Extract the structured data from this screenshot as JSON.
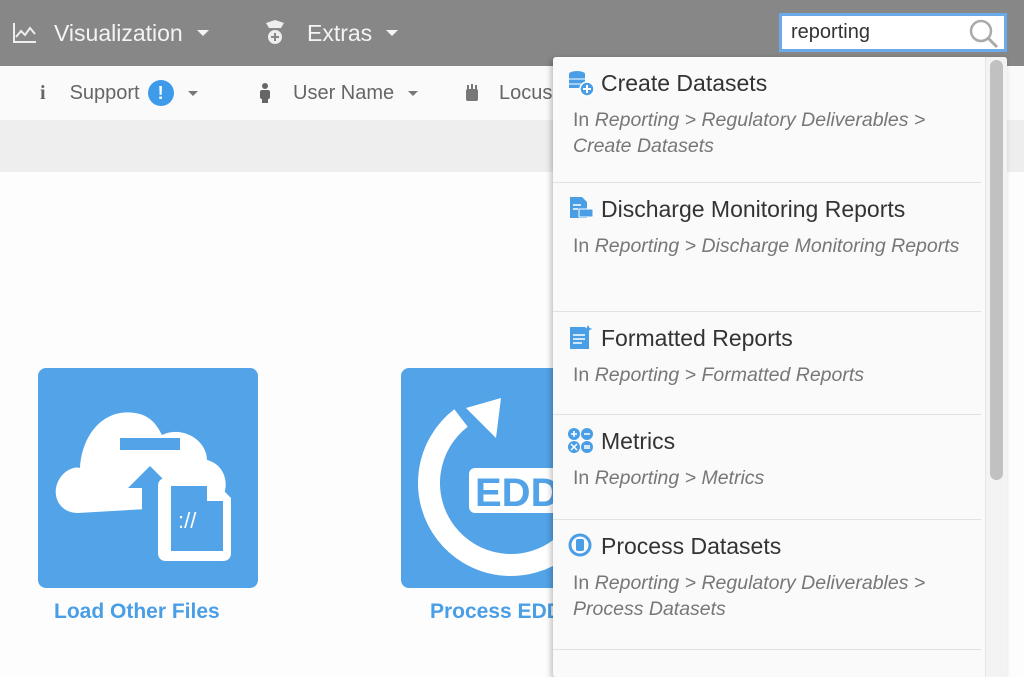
{
  "topbar": {
    "items": [
      {
        "label": "Visualization",
        "icon": "chart-icon"
      },
      {
        "label": "Extras",
        "icon": "extras-icon"
      }
    ],
    "search": {
      "value": "reporting",
      "icon": "search-icon"
    }
  },
  "subbar": {
    "items": [
      {
        "label": "Support",
        "icon": "info-icon",
        "badge": "!"
      },
      {
        "label": "User Name",
        "icon": "user-icon"
      },
      {
        "label": "Locus",
        "icon": "locus-icon"
      }
    ]
  },
  "tiles": [
    {
      "label": "Load Other Files",
      "icon": "cloud-upload-file-icon"
    },
    {
      "label": "Process EDD",
      "icon": "edd-process-icon",
      "icon_text": "EDD"
    }
  ],
  "results": [
    {
      "title": "Create Datasets",
      "prefix": "In",
      "path": "Reporting > Regulatory Deliverables > Create Datasets",
      "icon": "database-add-icon"
    },
    {
      "title": "Discharge Monitoring Reports",
      "prefix": "In",
      "path": "Reporting > Discharge Monitoring Reports",
      "icon": "discharge-report-icon"
    },
    {
      "title": "Formatted Reports",
      "prefix": "In",
      "path": "Reporting > Formatted Reports",
      "icon": "formatted-report-icon"
    },
    {
      "title": "Metrics",
      "prefix": "In",
      "path": "Reporting > Metrics",
      "icon": "metrics-icon"
    },
    {
      "title": "Process Datasets",
      "prefix": "In",
      "path": "Reporting > Regulatory Deliverables > Process Datasets",
      "icon": "process-dataset-icon"
    }
  ],
  "colors": {
    "topbar": "#878787",
    "accent": "#52a3e7",
    "search_border": "#6aa9ea"
  }
}
